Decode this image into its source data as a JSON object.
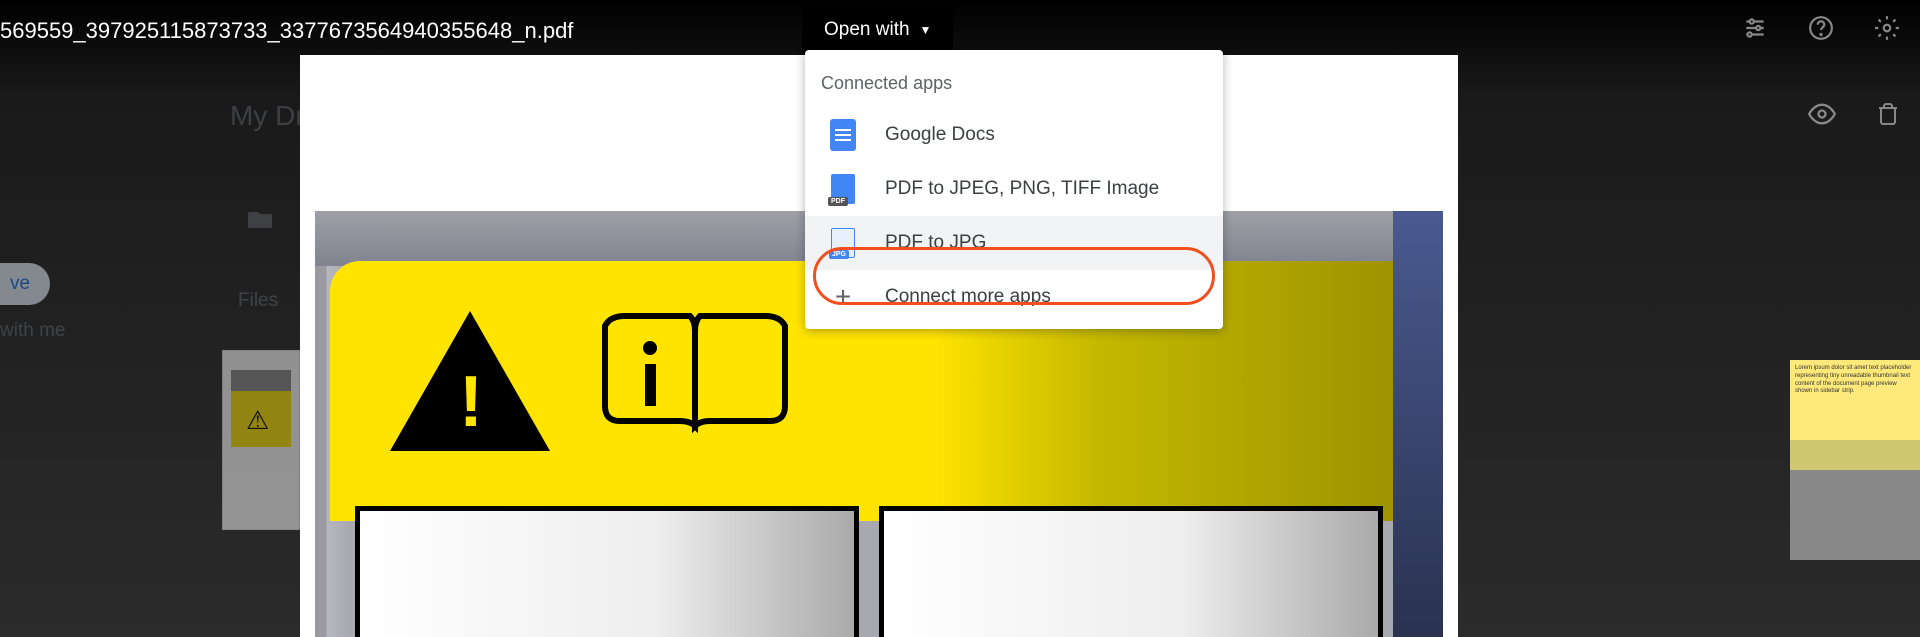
{
  "header": {
    "filename": "569559_397925115873733_3377673564940355648_n.pdf",
    "open_with_label": "Open with"
  },
  "drive_bg": {
    "breadcrumb": "My Dr",
    "sidebar_selected": "ve",
    "sidebar_shared": "with me",
    "files_label": "Files"
  },
  "dropdown": {
    "section_label": "Connected apps",
    "items": [
      {
        "label": "Google Docs",
        "icon": "docs"
      },
      {
        "label": "PDF to JPEG, PNG, TIFF Image",
        "icon": "pdf-converter"
      },
      {
        "label": "PDF to JPG",
        "icon": "pdf-jpg",
        "highlighted": true
      },
      {
        "label": "Connect more apps",
        "icon": "plus"
      }
    ]
  },
  "toolbar": {
    "icons_row1": [
      "tune",
      "help",
      "settings"
    ],
    "icons_row2": [
      "visibility",
      "delete"
    ]
  }
}
